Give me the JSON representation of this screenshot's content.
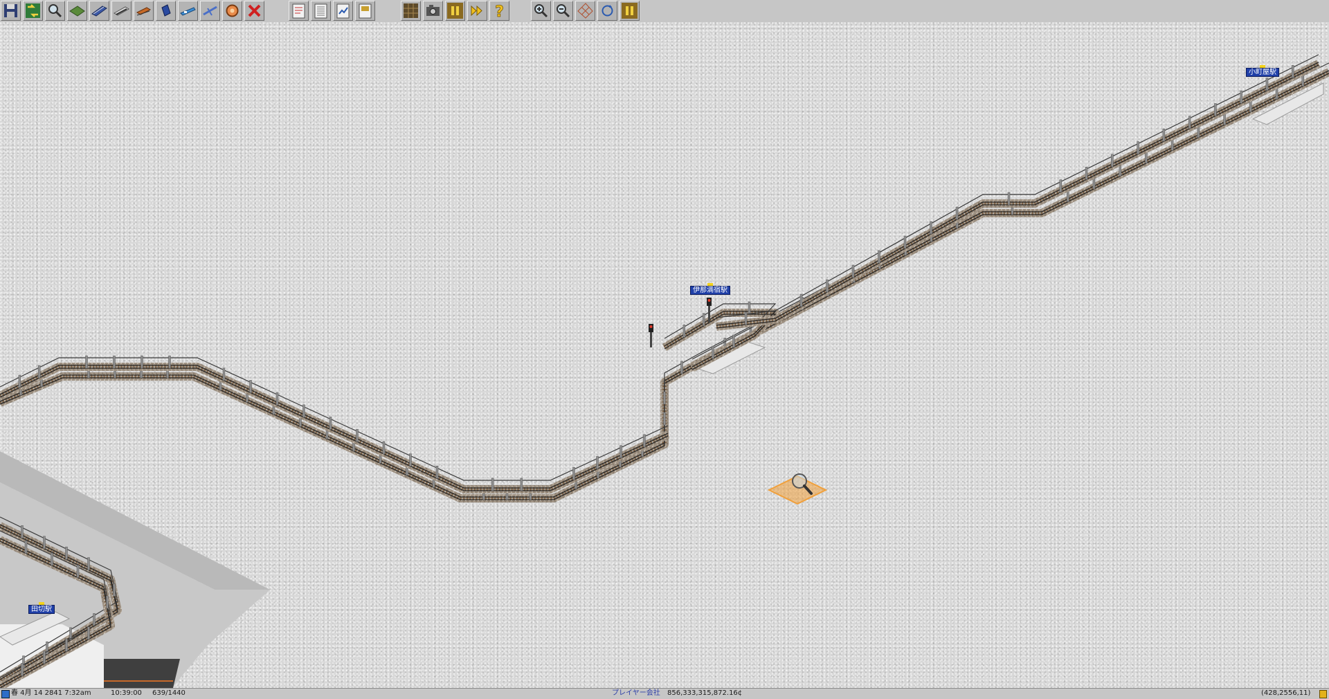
{
  "toolbar": {
    "groups": [
      {
        "tools": [
          "save-icon",
          "settings-icon",
          "query-tool-icon",
          "terrain-tool-icon",
          "rail-tool-icon",
          "monorail-tool-icon",
          "tram-tool-icon",
          "road-tool-icon",
          "ship-tool-icon",
          "airport-tool-icon",
          "special-construction-icon",
          "remove-tool-icon"
        ]
      },
      {
        "tools": [
          "line-management-icon",
          "list-icon",
          "finance-icon",
          "messages-icon"
        ]
      },
      {
        "tools": [
          "minimap-icon",
          "screenshot-icon",
          "pause-icon",
          "fast-forward-icon",
          "help-icon"
        ]
      },
      {
        "tools": [
          "zoom-in-icon",
          "zoom-out-icon",
          "grid-toggle-icon",
          "rotate-view-icon",
          "pause-icon"
        ]
      }
    ]
  },
  "map": {
    "stations": [
      {
        "label": "伊那満宿駅"
      },
      {
        "label": "小町屋駅"
      },
      {
        "label": "田切駅"
      }
    ]
  },
  "statusbar": {
    "date": "春 4月 14 2841  7:32am",
    "time": "10:39:00",
    "speed": "639/1440",
    "player": "プレイヤー会社",
    "money": "856,333,315,872.16¢",
    "coords": "(428,2556,11)"
  },
  "colors": {
    "station_sign": "#1f3fa8",
    "cursor_tile": "#f0a03c",
    "status_player": "#2c3ea8"
  }
}
